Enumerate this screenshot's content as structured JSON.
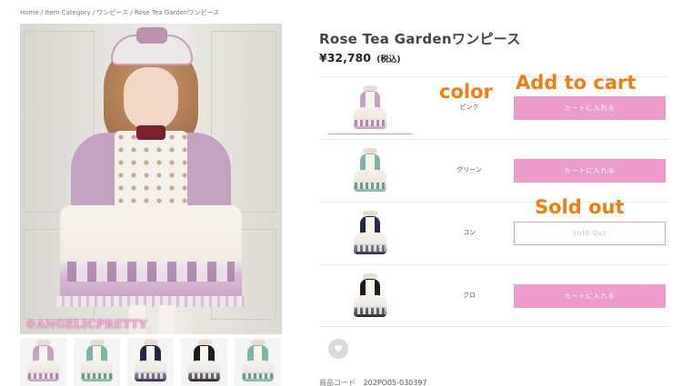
{
  "breadcrumb": "Home / Item Category / ワンピース / Rose Tea Gardenワンピース",
  "product": {
    "title": "Rose Tea Gardenワンピース",
    "price": "¥32,780",
    "tax_label": "(税込)",
    "watermark": "©ANGELICPRETTY"
  },
  "variants": [
    {
      "color": "ピンク",
      "button": "カートに入れる",
      "status": "available",
      "dress_color": "#c5a2c1",
      "band_color": "#a77fa7"
    },
    {
      "color": "グリーン",
      "button": "カートに入れる",
      "status": "available",
      "dress_color": "#7fb5a7",
      "band_color": "#5f8f84"
    },
    {
      "color": "コン",
      "button": "Sold Out",
      "status": "sold_out",
      "dress_color": "#24294a",
      "band_color": "#6d6f86"
    },
    {
      "color": "クロ",
      "button": "カートに入れる",
      "status": "available",
      "dress_color": "#1c1b1e",
      "band_color": "#5a5a60"
    }
  ],
  "thumbnails": [
    {
      "dress_color": "#c5a2c1",
      "band_color": "#a77fa7"
    },
    {
      "dress_color": "#7fb5a7",
      "band_color": "#5f8f84"
    },
    {
      "dress_color": "#24294a",
      "band_color": "#6d6f86"
    },
    {
      "dress_color": "#1c1b1e",
      "band_color": "#5a5a60"
    },
    {
      "dress_color": "#7fb5a7",
      "band_color": "#5f8f84"
    }
  ],
  "annotations": {
    "color": "color",
    "add_to_cart": "Add to cart",
    "sold_out": "Sold out"
  },
  "sku": {
    "label": "商品コード",
    "value": "202PO05-030397"
  },
  "favorite_icon": "heart-icon",
  "colors": {
    "accent_pink": "#ee9ccb",
    "annotation_orange": "#f07d12"
  }
}
